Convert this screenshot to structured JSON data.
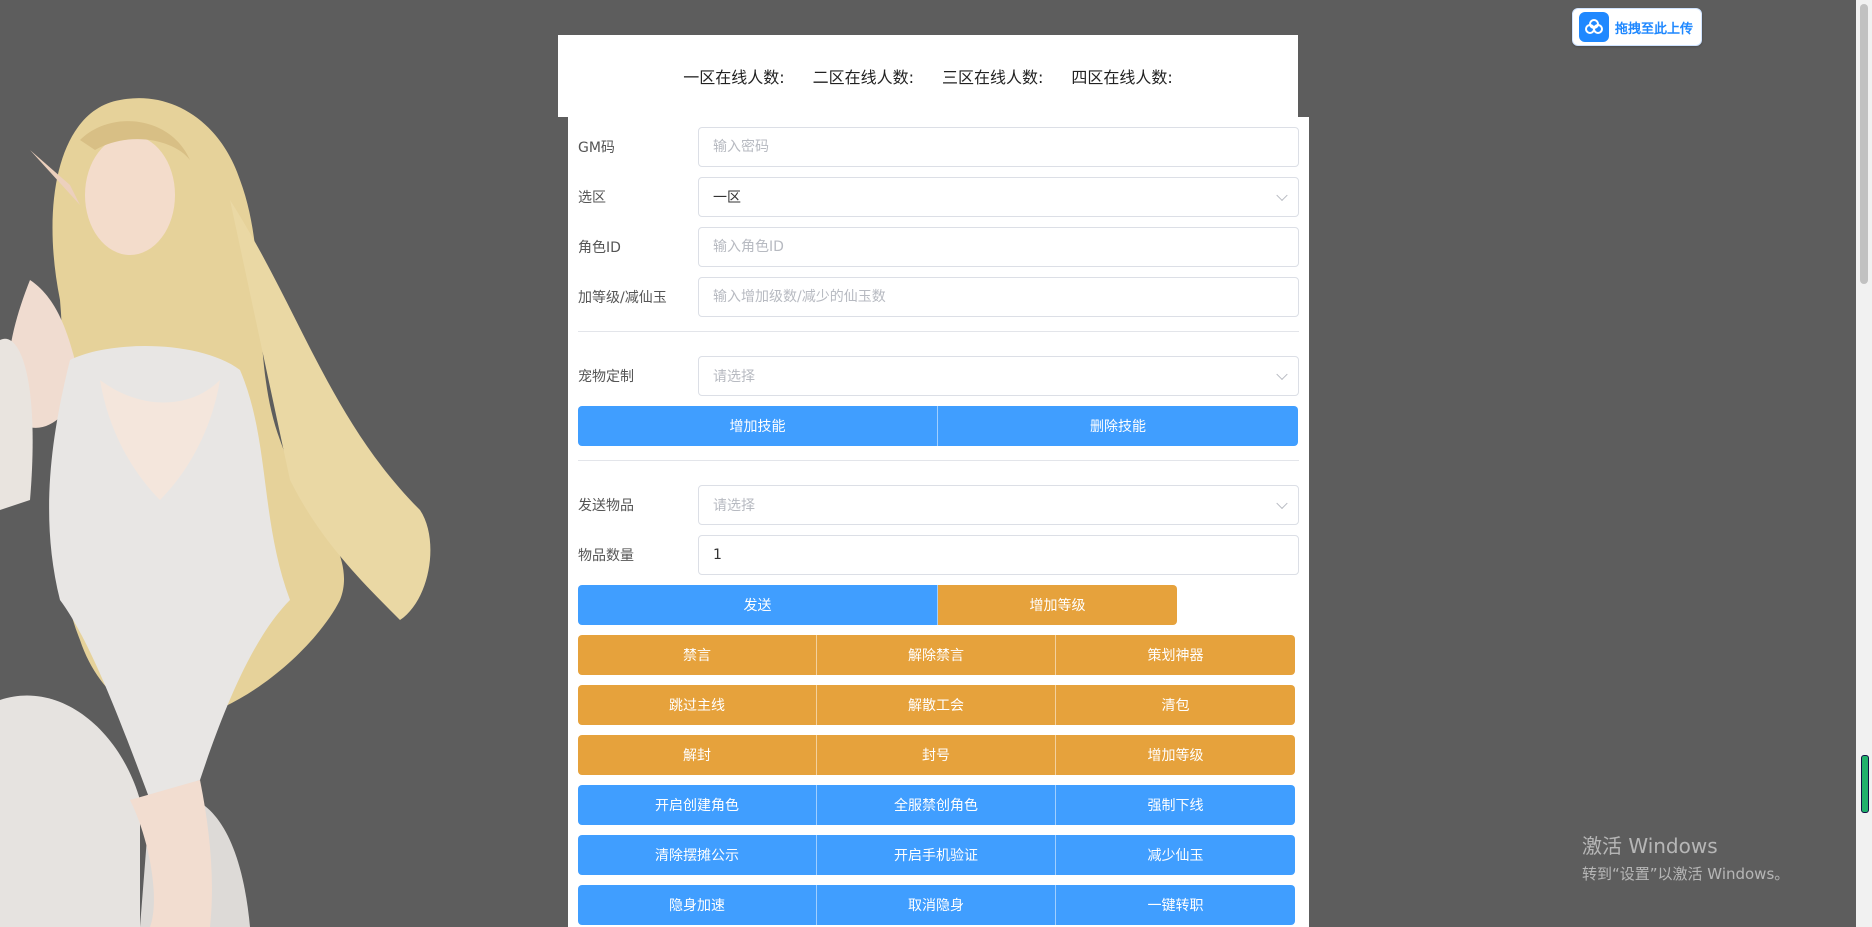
{
  "upload": {
    "label": "拖拽至此上传"
  },
  "online": {
    "zone1": "一区在线人数:",
    "zone2": "二区在线人数:",
    "zone3": "三区在线人数:",
    "zone4": "四区在线人数:"
  },
  "form": {
    "gm_code": {
      "label": "GM码",
      "placeholder": "输入密码",
      "value": ""
    },
    "zone": {
      "label": "选区",
      "value": "一区"
    },
    "role_id": {
      "label": "角色ID",
      "placeholder": "输入角色ID",
      "value": ""
    },
    "level_jade": {
      "label": "加等级/减仙玉",
      "placeholder": "输入增加级数/减少的仙玉数",
      "value": ""
    },
    "pet": {
      "label": "宠物定制",
      "placeholder": "请选择"
    },
    "item": {
      "label": "发送物品",
      "placeholder": "请选择"
    },
    "item_qty": {
      "label": "物品数量",
      "value": "1"
    }
  },
  "buttons": {
    "add_skill": "增加技能",
    "delete_skill": "删除技能",
    "send": "发送",
    "add_level": "增加等级",
    "row1": [
      "禁言",
      "解除禁言",
      "策划神器"
    ],
    "row2": [
      "跳过主线",
      "解散工会",
      "清包"
    ],
    "row3": [
      "解封",
      "封号",
      "增加等级"
    ],
    "row4": [
      "开启创建角色",
      "全服禁创角色",
      "强制下线"
    ],
    "row5": [
      "清除摆摊公示",
      "开启手机验证",
      "减少仙玉"
    ],
    "row6": [
      "隐身加速",
      "取消隐身",
      "一键转职"
    ]
  },
  "watermark": {
    "title": "激活 Windows",
    "subtitle": "转到“设置”以激活 Windows。"
  },
  "colors": {
    "primary": "#409eff",
    "warning": "#e6a23c",
    "background": "#5d5d5d"
  }
}
